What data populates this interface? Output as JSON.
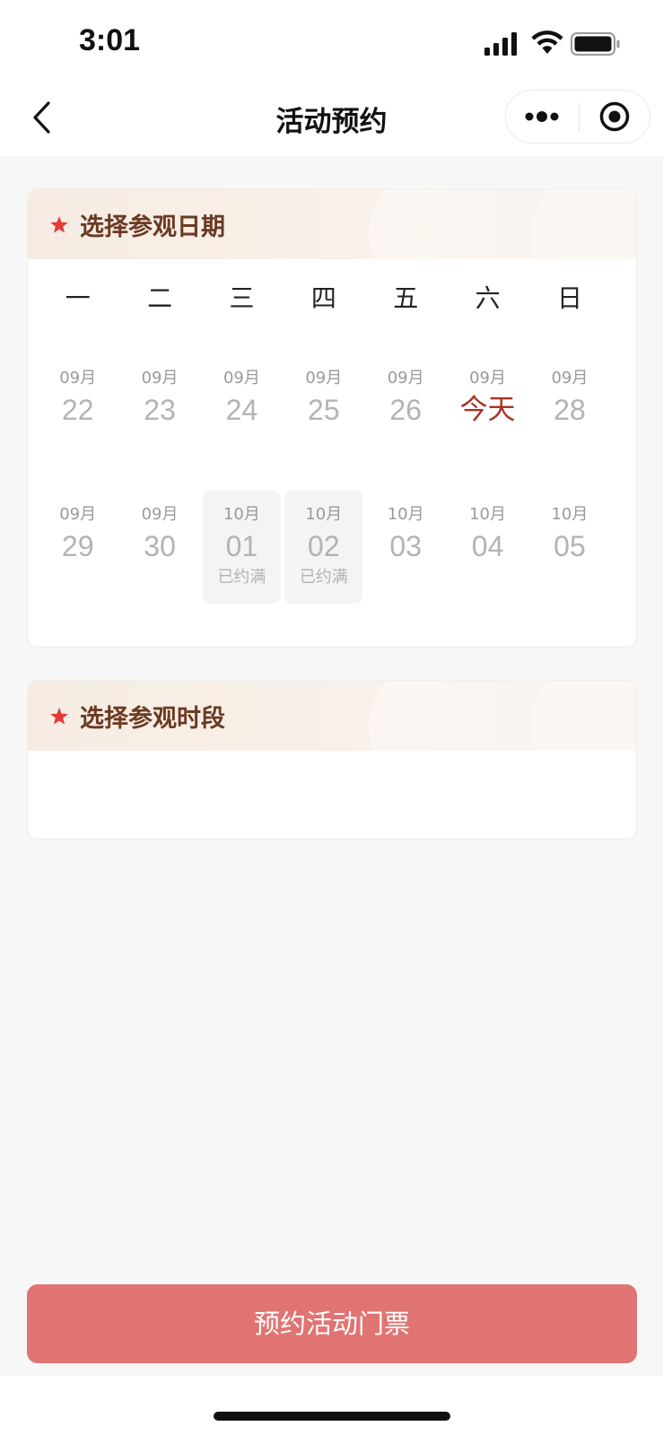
{
  "status_bar": {
    "time": "3:01"
  },
  "nav": {
    "title": "活动预约"
  },
  "date_section": {
    "title": "选择参观日期",
    "weekdays": [
      "一",
      "二",
      "三",
      "四",
      "五",
      "六",
      "日"
    ],
    "weeks": [
      [
        {
          "month": "09月",
          "day": "22",
          "status": ""
        },
        {
          "month": "09月",
          "day": "23",
          "status": ""
        },
        {
          "month": "09月",
          "day": "24",
          "status": ""
        },
        {
          "month": "09月",
          "day": "25",
          "status": ""
        },
        {
          "month": "09月",
          "day": "26",
          "status": ""
        },
        {
          "month": "09月",
          "day": "今天",
          "status": ""
        },
        {
          "month": "09月",
          "day": "28",
          "status": ""
        }
      ],
      [
        {
          "month": "09月",
          "day": "29",
          "status": ""
        },
        {
          "month": "09月",
          "day": "30",
          "status": ""
        },
        {
          "month": "10月",
          "day": "01",
          "status": "已约满"
        },
        {
          "month": "10月",
          "day": "02",
          "status": "已约满"
        },
        {
          "month": "10月",
          "day": "03",
          "status": ""
        },
        {
          "month": "10月",
          "day": "04",
          "status": ""
        },
        {
          "month": "10月",
          "day": "05",
          "status": ""
        }
      ]
    ]
  },
  "time_section": {
    "title": "选择参观时段"
  },
  "submit": {
    "label": "预约活动门票"
  },
  "colors": {
    "accent": "#e07472",
    "today": "#a83224",
    "section_title": "#6b3a22",
    "star": "#e23b3b"
  },
  "icons": [
    "signal-icon",
    "wifi-icon",
    "battery-icon",
    "back-icon",
    "more-icon",
    "close-target-icon",
    "star-icon"
  ]
}
